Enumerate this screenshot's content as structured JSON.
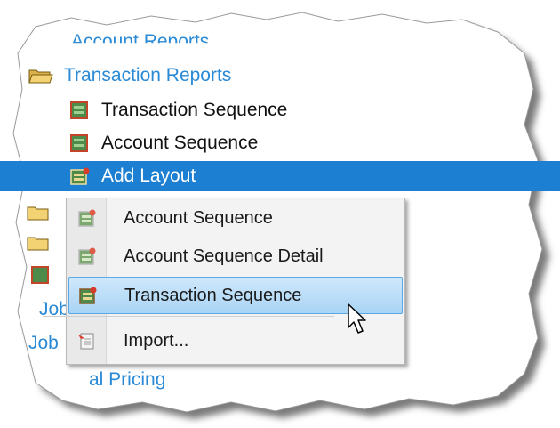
{
  "tree": {
    "account_reports": "Account Reports",
    "transaction_reports": "Transaction Reports",
    "transaction_sequence": "Transaction Sequence",
    "account_sequence": "Account Sequence",
    "add_layout": "Add Layout",
    "job_1": "Job",
    "job_2": "Job",
    "pricing": "al Pricing"
  },
  "context_menu": {
    "items": [
      {
        "label": "Account Sequence"
      },
      {
        "label": "Account Sequence Detail"
      },
      {
        "label": "Transaction Sequence"
      },
      {
        "label": "Import..."
      }
    ]
  },
  "colors": {
    "selection": "#1c7fd1",
    "link": "#2a8ad6",
    "menu_hover": "#a9d4f5"
  }
}
